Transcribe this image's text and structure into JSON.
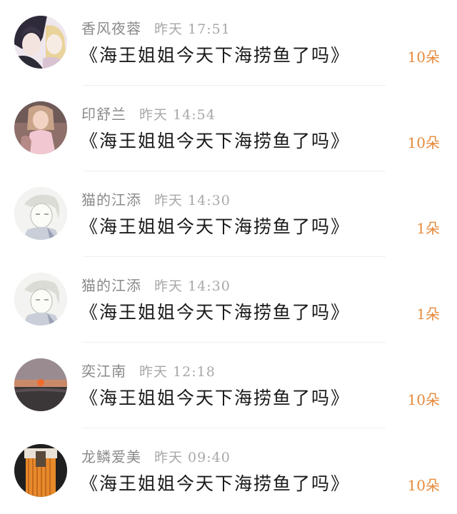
{
  "list": {
    "items": [
      {
        "username": "香风夜蓉",
        "time": "昨天 17:51",
        "gift": "《海王姐姐今天下海捞鱼了吗》",
        "count": "10朵",
        "avatar": "anime-duo-avatar"
      },
      {
        "username": "印舒兰",
        "time": "昨天 14:54",
        "gift": "《海王姐姐今天下海捞鱼了吗》",
        "count": "10朵",
        "avatar": "photo-woman-avatar"
      },
      {
        "username": "猫的江添",
        "time": "昨天 14:30",
        "gift": "《海王姐姐今天下海捞鱼了吗》",
        "count": "1朵",
        "avatar": "anime-sketch-avatar"
      },
      {
        "username": "猫的江添",
        "time": "昨天 14:30",
        "gift": "《海王姐姐今天下海捞鱼了吗》",
        "count": "1朵",
        "avatar": "anime-sketch-avatar"
      },
      {
        "username": "奕江南",
        "time": "昨天 12:18",
        "gift": "《海王姐姐今天下海捞鱼了吗》",
        "count": "10朵",
        "avatar": "sunset-avatar"
      },
      {
        "username": "龙鳞爱美",
        "time": "昨天 09:40",
        "gift": "《海王姐姐今天下海捞鱼了吗》",
        "count": "10朵",
        "avatar": "orange-curtain-avatar"
      }
    ]
  },
  "colors": {
    "count": "#e58a3a",
    "username": "#8a8a8a",
    "time": "#a8a8a8",
    "title": "#1a1a1a",
    "divider": "#efefef"
  }
}
